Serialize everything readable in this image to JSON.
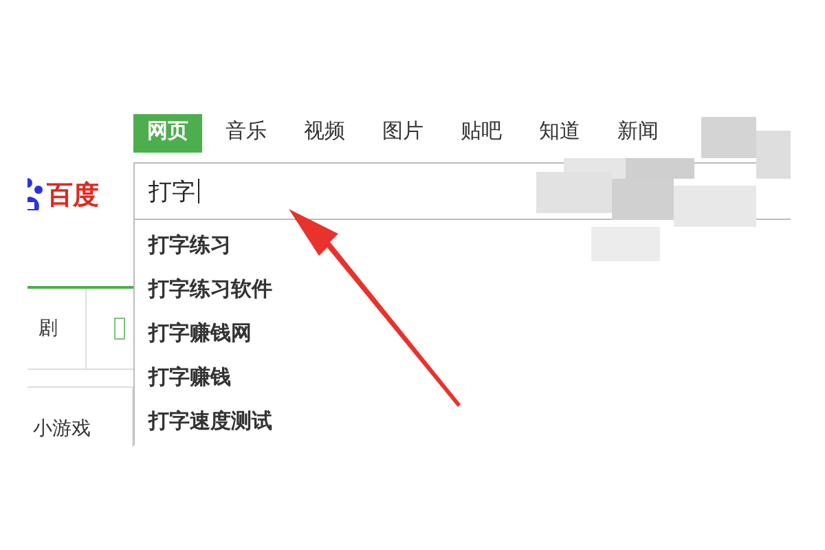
{
  "tabs": [
    {
      "label": "网页",
      "selected": true
    },
    {
      "label": "音乐",
      "selected": false
    },
    {
      "label": "视频",
      "selected": false
    },
    {
      "label": "图片",
      "selected": false
    },
    {
      "label": "贴吧",
      "selected": false
    },
    {
      "label": "知道",
      "selected": false
    },
    {
      "label": "新闻",
      "selected": false
    }
  ],
  "logo": {
    "text": "百度"
  },
  "search": {
    "value": "打字"
  },
  "suggestions": [
    "打字练习",
    "打字练习软件",
    "打字赚钱网",
    "打字赚钱",
    "打字速度测试"
  ],
  "side": {
    "tab": "剧",
    "link": "小游戏"
  }
}
